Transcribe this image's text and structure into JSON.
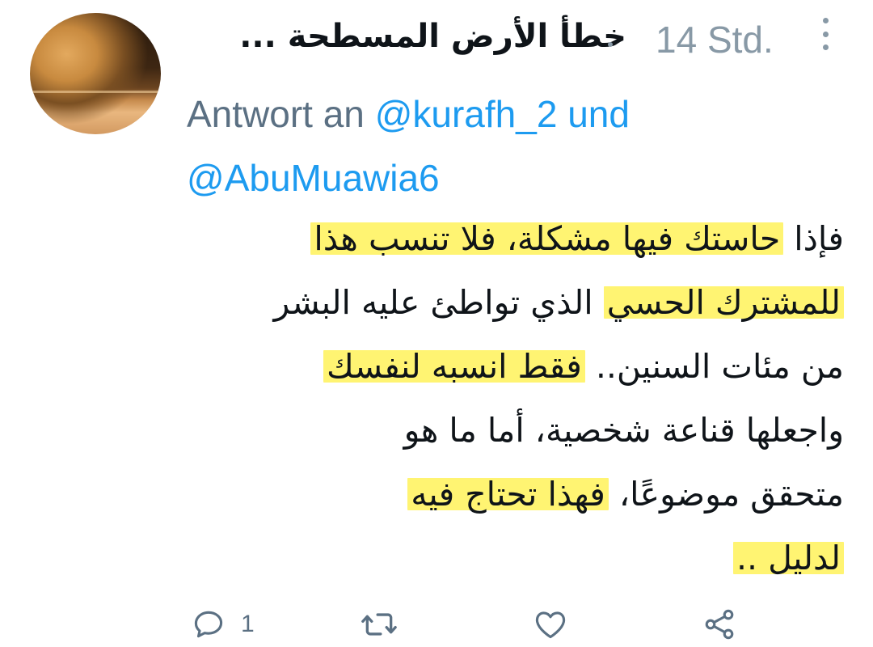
{
  "tweet": {
    "display_name": "خطأ الأرض المسطحة ...",
    "timestamp": "14 Std.",
    "reply_prefix": "Antwort an",
    "mention_1": "@kurafh_2",
    "reply_and": "und",
    "mention_2": "@AbuMuawia6",
    "body_segments": {
      "l1_a": "فإذا ",
      "l1_b": "حاستك فيها مشكلة، فلا تنسب هذا",
      "l2_a": "للمشترك الحسي",
      "l2_b": " الذي تواطئ عليه البشر",
      "l3_a": "من مئات السنين.. ",
      "l3_b": "فقط انسبه لنفسك",
      "l4_a": "واجعلها قناعة شخصية، أما ما هو",
      "l5_a": "متحقق موضوعًا، ",
      "l5_b": "فهذا تحتاج فيه",
      "l6_a": "لدليل .."
    },
    "actions": {
      "reply_count": "1",
      "retweet_count": "",
      "like_count": ""
    }
  },
  "colors": {
    "muted": "#8899a6",
    "link": "#1d9bf0",
    "highlight": "#fff03c"
  },
  "icons": [
    "more-vertical-icon",
    "reply-icon",
    "retweet-icon",
    "like-icon",
    "share-icon"
  ]
}
